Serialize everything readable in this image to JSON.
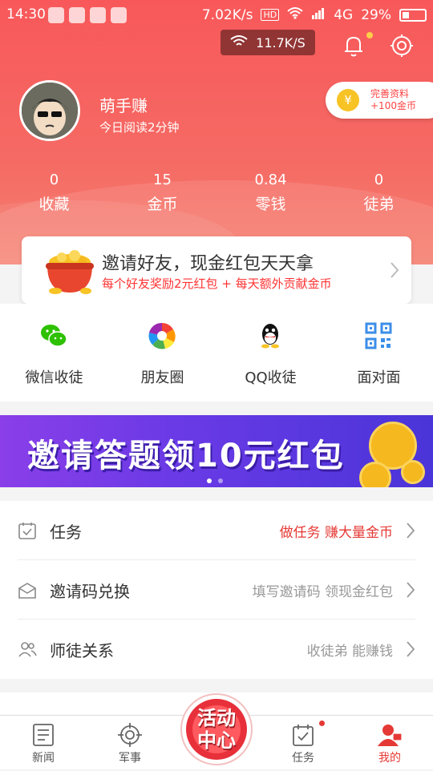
{
  "status_bar": {
    "time": "14:30",
    "net_speed": "7.02K/s",
    "hd": "HD",
    "network": "4G",
    "battery": "29%"
  },
  "wifi_speed": "11.7K/S",
  "user": {
    "name": "萌手赚",
    "read_time": "今日阅读2分钟"
  },
  "profile_pill": {
    "line1": "完善资料",
    "line2": "+100金币",
    "coin_glyph": "¥"
  },
  "stats": [
    {
      "value": "0",
      "label": "收藏"
    },
    {
      "value": "15",
      "label": "金币"
    },
    {
      "value": "0.84",
      "label": "零钱"
    },
    {
      "value": "0",
      "label": "徒弟"
    }
  ],
  "invite": {
    "title": "邀请好友，现金红包天天拿",
    "subtitle": "每个好友奖励2元红包 + 每天额外贡献金币"
  },
  "share": [
    {
      "label": "微信收徒",
      "icon": "wechat-icon"
    },
    {
      "label": "朋友圈",
      "icon": "moments-icon"
    },
    {
      "label": "QQ收徒",
      "icon": "qq-icon"
    },
    {
      "label": "面对面",
      "icon": "qrcode-icon"
    }
  ],
  "banner": {
    "text": "邀请答题领10元红包",
    "page_count": 2,
    "active_page": 1
  },
  "menu": [
    {
      "title": "任务",
      "hint": "做任务 赚大量金币",
      "hint_red": true,
      "icon": "calendar-check-icon"
    },
    {
      "title": "邀请码兑换",
      "hint": "填写邀请码 领现金红包",
      "hint_red": false,
      "icon": "envelope-icon"
    },
    {
      "title": "师徒关系",
      "hint": "收徒弟 能赚钱",
      "hint_red": false,
      "icon": "people-icon"
    }
  ],
  "center_button": {
    "line1": "活动",
    "line2": "中心"
  },
  "tabs": [
    {
      "label": "新闻",
      "icon": "news-icon",
      "active": false,
      "dot": false
    },
    {
      "label": "军事",
      "icon": "crosshair-icon",
      "active": false,
      "dot": false
    },
    {
      "label": "任务",
      "icon": "task-icon",
      "active": false,
      "dot": true
    },
    {
      "label": "我的",
      "icon": "profile-icon",
      "active": true,
      "dot": false
    }
  ],
  "colors": {
    "accent": "#f55a5a",
    "accent_red": "#e53935",
    "banner_purple": "#6a3ae6",
    "gold": "#f7c325"
  }
}
